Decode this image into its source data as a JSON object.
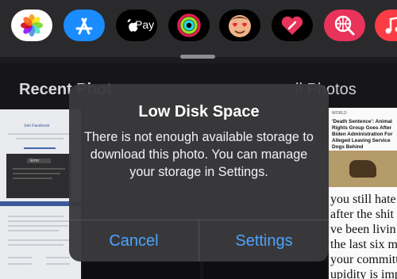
{
  "app_strip": {
    "apps": [
      {
        "name": "Photos",
        "icon": "photos-icon"
      },
      {
        "name": "App Store",
        "icon": "app-store-icon"
      },
      {
        "name": "Apple Pay",
        "icon": "apple-pay-icon",
        "label": "Pay"
      },
      {
        "name": "Activity",
        "icon": "activity-rings-icon"
      },
      {
        "name": "Memoji",
        "icon": "memoji-icon"
      },
      {
        "name": "Heart Sticker",
        "icon": "heart-icon"
      },
      {
        "name": "Images Search",
        "icon": "globe-search-icon"
      },
      {
        "name": "Music",
        "icon": "music-note-icon"
      }
    ]
  },
  "browser": {
    "header_left": "Recent Phot",
    "header_right": "ll Photos",
    "thumbnails": {
      "fb": {
        "title": "Join Facebook",
        "error_label": "Error"
      },
      "news": {
        "tag": "WORLD",
        "headline": "'Death Sentence': Animal Rights Group Goes After Biden Administration For Alleged Leaving Service Dogs Behind",
        "lines": [
          "you still hate T",
          "after the shit sl",
          "ve been livin",
          "the last six mor",
          "your committmen",
          "upidity is impro"
        ]
      }
    }
  },
  "alert": {
    "title": "Low Disk Space",
    "message": "There is not enough available storage to download this photo. You can manage your storage in Settings.",
    "cancel_label": "Cancel",
    "settings_label": "Settings"
  },
  "colors": {
    "accent": "#4da3ff",
    "alert_bg": "#3a3a3c",
    "background": "#1c1c1e"
  }
}
